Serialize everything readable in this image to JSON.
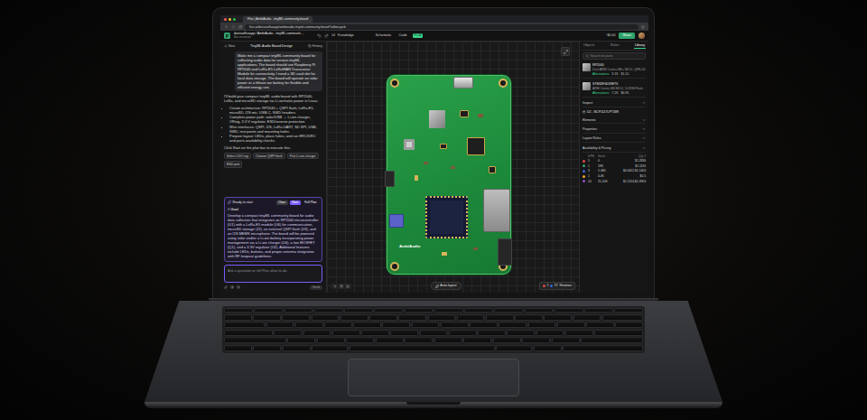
{
  "browser": {
    "tab": "Flux | AmbiAudio - tinyML community board",
    "url": "flux.ai/dariuszfluxapp/ambiaudio-tinyml-community-board?editor=pcb"
  },
  "header": {
    "project": "dariuszfluxapp / AmbiAudio - tinyML communit…",
    "subtitle": "Not versioned",
    "zoom": "14",
    "menu": "Knowledge",
    "views": [
      {
        "label": "Schematic",
        "selected": false
      },
      {
        "label": "Code",
        "selected": false
      },
      {
        "label": "PCB",
        "selected": true
      }
    ],
    "credits": "~$0.00",
    "share": "Share"
  },
  "chat": {
    "new": "New",
    "title": "TinyML Audio Board Design",
    "history": "History",
    "prompt": "Make me a compact tinyML community board for collecting audio data for various tinyML applications. The board should use Raspberry Pi RP2040 and LoRa E5 LoRaWAN Transceiver Module for connectivity. I need a SD card slot for local data storage. The board will operate on solar power or a lithium ion battery for flexible and efficient energy use.",
    "reply": "I'll build your compact tinyML audio board with RP2040, LoRa, and microSD storage via Li-ion/solar power in Linux.",
    "bullets": [
      "Create architecture: RP2040 + QSPI flash, LoRa-E5, microSD, I2S mic, USB-C, SWD headers.",
      "Complete power path: solar/USB → Li-ion charger, ORing, 3.3 V regulator, ESD/reverse protection.",
      "Wire interfaces: QSPI, I2S, LoRa UART, SD SPI, USB, SWD, test points and mounting holes.",
      "Prepare layout: LEDs, place holes, and run ERC/DRC and parts availability checks."
    ],
    "outro": "Click Start on the plan bar to execute this.",
    "suggestions": [
      "Select LDO reg",
      "Choose QSPI flash",
      "Pick Li-ion charger",
      "ESD prot"
    ]
  },
  "plan": {
    "status": "Ready to start",
    "clear": "Clear",
    "start": "Start",
    "full": "Full Plan",
    "heading": "# Goal",
    "text": "Develop a compact tinyML community board for audio data collection that integrates an RP2040 microcontroller (U1) with a LoRa-E5 module (U6) for communication, microSD storage (J2), an external QSPI flash (U3), and an I2S MEMS microphone. The board will be powered using solar and/or a Li-ion battery incorporating power management via a Li-ion charger (U4), a low MOSFET (Q1), and a 3.3V regulator (U2). Additional features include LEDs, buttons, and proper antenna integration with RF keepout guidelines."
  },
  "input": {
    "placeholder": "Ask a question or tell Flux what to do",
    "send": "Send"
  },
  "canvas": {
    "board_label": "AmbiAudio",
    "autolayout": "Auto-layout",
    "reviews": {
      "label": "Reviews",
      "counts": [
        {
          "count": "1",
          "color": "#e5484d"
        },
        {
          "count": "72",
          "color": "#3e63dd"
        }
      ]
    }
  },
  "right": {
    "tabs": [
      {
        "label": "Objects",
        "selected": false
      },
      {
        "label": "Rules",
        "selected": false
      },
      {
        "label": "Library",
        "selected": true
      }
    ],
    "search": "Search for parts",
    "parts": [
      {
        "name": "RP2040",
        "desc": "Dual ARM Cortex-M0+ MCU, QFN-56",
        "tag": "Alternatives",
        "stock": "3.1K",
        "price": "$1.10"
      },
      {
        "name": "STM32F401RET6",
        "desc": "ARM Cortex-M4 MCU, 512KB Flash",
        "tag": "Alternatives",
        "stock": "7.2K",
        "price": "$6.96"
      }
    ],
    "inspect": "Inspect",
    "selected_part": "U2 - NCP1117LPT33R",
    "sections": [
      "Elements",
      "Properties",
      "Layout Rules"
    ],
    "pricing": {
      "title": "Availability & Pricing",
      "columns": [
        "DPN",
        "Stock",
        "Qty 1"
      ],
      "rows": [
        {
          "dpn": "5",
          "stock": "0",
          "price": "$1.2836",
          "color": "#e5484d"
        },
        {
          "dpn": "1",
          "stock": "19K",
          "price": "$1.1135",
          "color": "#30a46c"
        },
        {
          "dpn": "3",
          "stock": "2-46K",
          "price": "$0.0622-$1.1403",
          "color": "#3e63dd"
        },
        {
          "dpn": "1",
          "stock": "4.4K",
          "price": "$0.5",
          "color": "#f5a623"
        },
        {
          "dpn": "14",
          "stock": "25-10K",
          "price": "$1.1224-$1.3903",
          "color": "#8e4ec6"
        }
      ]
    }
  }
}
